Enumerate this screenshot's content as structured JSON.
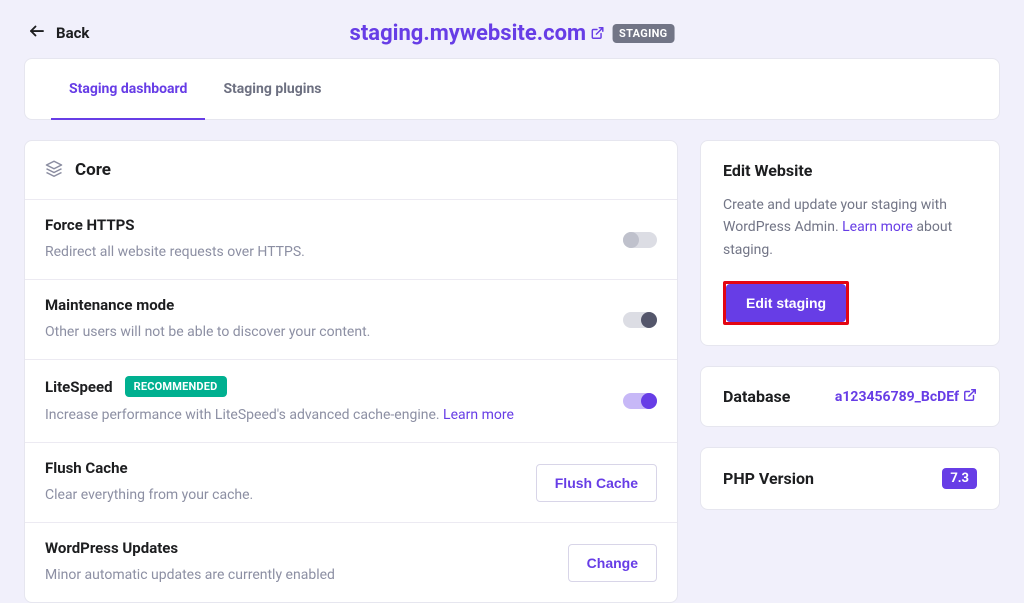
{
  "back_label": "Back",
  "site_url": "staging.mywebsite.com",
  "env_badge": "STAGING",
  "tabs": [
    {
      "label": "Staging dashboard"
    },
    {
      "label": "Staging plugins"
    }
  ],
  "core": {
    "header": "Core",
    "https": {
      "title": "Force HTTPS",
      "desc": "Redirect all website requests over HTTPS."
    },
    "maintenance": {
      "title": "Maintenance mode",
      "desc": "Other users will not be able to discover your content."
    },
    "litespeed": {
      "title": "LiteSpeed",
      "badge": "RECOMMENDED",
      "desc_prefix": "Increase performance with LiteSpeed's advanced cache-engine. ",
      "learn_more": "Learn more"
    },
    "flush": {
      "title": "Flush Cache",
      "desc": "Clear everything from your cache.",
      "button": "Flush Cache"
    },
    "wp_updates": {
      "title": "WordPress Updates",
      "desc": "Minor automatic updates are currently enabled",
      "button": "Change"
    }
  },
  "edit": {
    "header": "Edit Website",
    "desc_prefix": "Create and update your staging with WordPress Admin. ",
    "learn_more": "Learn more",
    "desc_suffix": " about staging.",
    "button": "Edit staging"
  },
  "database": {
    "header": "Database",
    "value": "a123456789_BcDEf"
  },
  "php": {
    "header": "PHP Version",
    "version": "7.3"
  }
}
